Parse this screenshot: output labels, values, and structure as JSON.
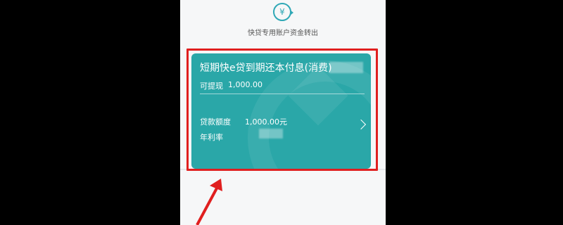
{
  "header": {
    "icon": "yuan-transfer-icon",
    "subtitle": "快贷专用账户资金转出"
  },
  "card": {
    "title": "短期快e贷到期还本付息(消费)",
    "withdrawable_label": "可提现",
    "withdrawable_value": "1,000.00",
    "loan_amount_label": "贷款额度",
    "loan_amount_value": "1,000.00元",
    "interest_label": "年利率",
    "color": "#2aa7a8"
  },
  "annotation": {
    "highlight_color": "#e01f1f"
  }
}
